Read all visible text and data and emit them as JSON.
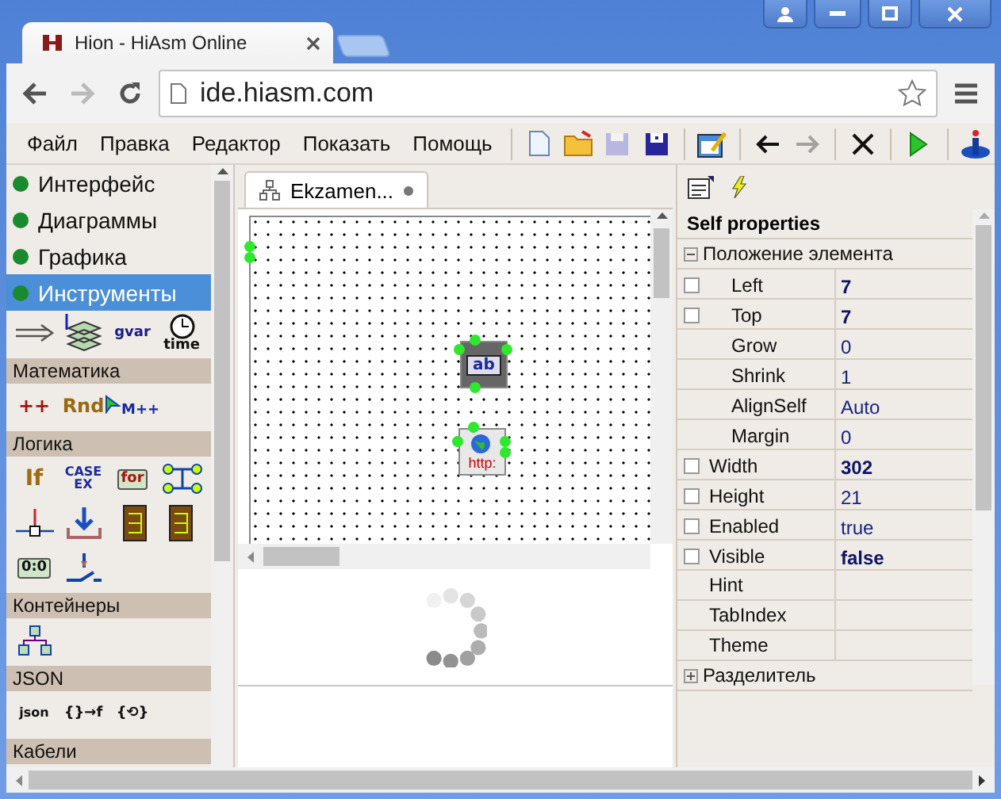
{
  "browser": {
    "tab_title": "Hion - HiAsm Online",
    "url": "ide.hiasm.com",
    "back_disabled": false,
    "forward_disabled": true
  },
  "menu": [
    "Файл",
    "Правка",
    "Редактор",
    "Показать",
    "Помощь"
  ],
  "toolbar": [
    [
      {
        "kind": "new",
        "disabled": false
      },
      {
        "kind": "open",
        "disabled": false
      },
      {
        "kind": "save",
        "disabled": true
      },
      {
        "kind": "saveas",
        "disabled": false
      }
    ],
    [
      {
        "kind": "edit",
        "disabled": false
      }
    ],
    [
      {
        "kind": "back",
        "disabled": false
      },
      {
        "kind": "forward",
        "disabled": true
      }
    ],
    [
      {
        "kind": "delete",
        "disabled": false
      }
    ],
    [
      {
        "kind": "run",
        "disabled": false
      }
    ],
    [
      {
        "kind": "info",
        "disabled": false
      }
    ]
  ],
  "palette": {
    "categories": [
      {
        "label": "Интерфейс",
        "selected": false
      },
      {
        "label": "Диаграммы",
        "selected": false
      },
      {
        "label": "Графика",
        "selected": false
      },
      {
        "label": "Инструменты",
        "selected": true
      }
    ],
    "sections": [
      {
        "items": [
          {
            "kind": "arrow"
          },
          {
            "kind": "layers"
          },
          {
            "kind": "gvar",
            "text": "gvar"
          },
          {
            "kind": "clock",
            "text": "time"
          }
        ]
      },
      {
        "title": "Математика",
        "items": [
          {
            "kind": "inc",
            "text": "++"
          },
          {
            "kind": "rnd",
            "text": "Rnd"
          },
          {
            "kind": "cursor",
            "text": "M++"
          }
        ]
      },
      {
        "title": "Логика",
        "items": [
          {
            "kind": "if",
            "text": "If"
          },
          {
            "kind": "case",
            "text": "CASE EX"
          },
          {
            "kind": "for",
            "text": "for"
          },
          {
            "kind": "hub"
          },
          {
            "kind": "axis"
          },
          {
            "kind": "inbox"
          },
          {
            "kind": "blockleft"
          },
          {
            "kind": "blockright"
          },
          {
            "kind": "counter",
            "text": "0:0"
          },
          {
            "kind": "switch"
          }
        ]
      },
      {
        "title": "Контейнеры",
        "items": [
          {
            "kind": "tree"
          }
        ]
      },
      {
        "title": "JSON",
        "items": [
          {
            "kind": "json",
            "text": "json"
          },
          {
            "kind": "code",
            "text": "{}→f"
          },
          {
            "kind": "code",
            "text": "{⟲}"
          }
        ]
      },
      {
        "title": "Кабели"
      }
    ]
  },
  "editor": {
    "tab": "Ekzamen...",
    "components": [
      {
        "kind": "edit",
        "text": "ab"
      },
      {
        "kind": "http",
        "text": "http:"
      }
    ]
  },
  "properties": {
    "tabs": [
      {
        "kind": "props"
      },
      {
        "kind": "events"
      }
    ],
    "title": "Self properties",
    "rows": [
      {
        "kind": "group",
        "name": "Положение элемента",
        "expanded": true,
        "children": [
          {
            "name": "Left",
            "value": "7",
            "modified": true,
            "checked": false
          },
          {
            "name": "Top",
            "value": "7",
            "modified": true,
            "checked": false
          },
          {
            "name": "Grow",
            "value": "0",
            "modified": false
          },
          {
            "name": "Shrink",
            "value": "1",
            "modified": false
          },
          {
            "name": "AlignSelf",
            "value": "Auto",
            "modified": false
          },
          {
            "name": "Margin",
            "value": "0",
            "modified": false
          }
        ]
      },
      {
        "name": "Width",
        "value": "302",
        "modified": true,
        "checked": false
      },
      {
        "name": "Height",
        "value": "21",
        "modified": false,
        "checked": false
      },
      {
        "name": "Enabled",
        "value": "true",
        "modified": false,
        "checked": false
      },
      {
        "name": "Visible",
        "value": "false",
        "modified": true,
        "checked": false
      },
      {
        "name": "Hint"
      },
      {
        "name": "TabIndex"
      },
      {
        "name": "Theme"
      },
      {
        "kind": "group",
        "name": "Разделитель",
        "expanded": false
      }
    ]
  }
}
